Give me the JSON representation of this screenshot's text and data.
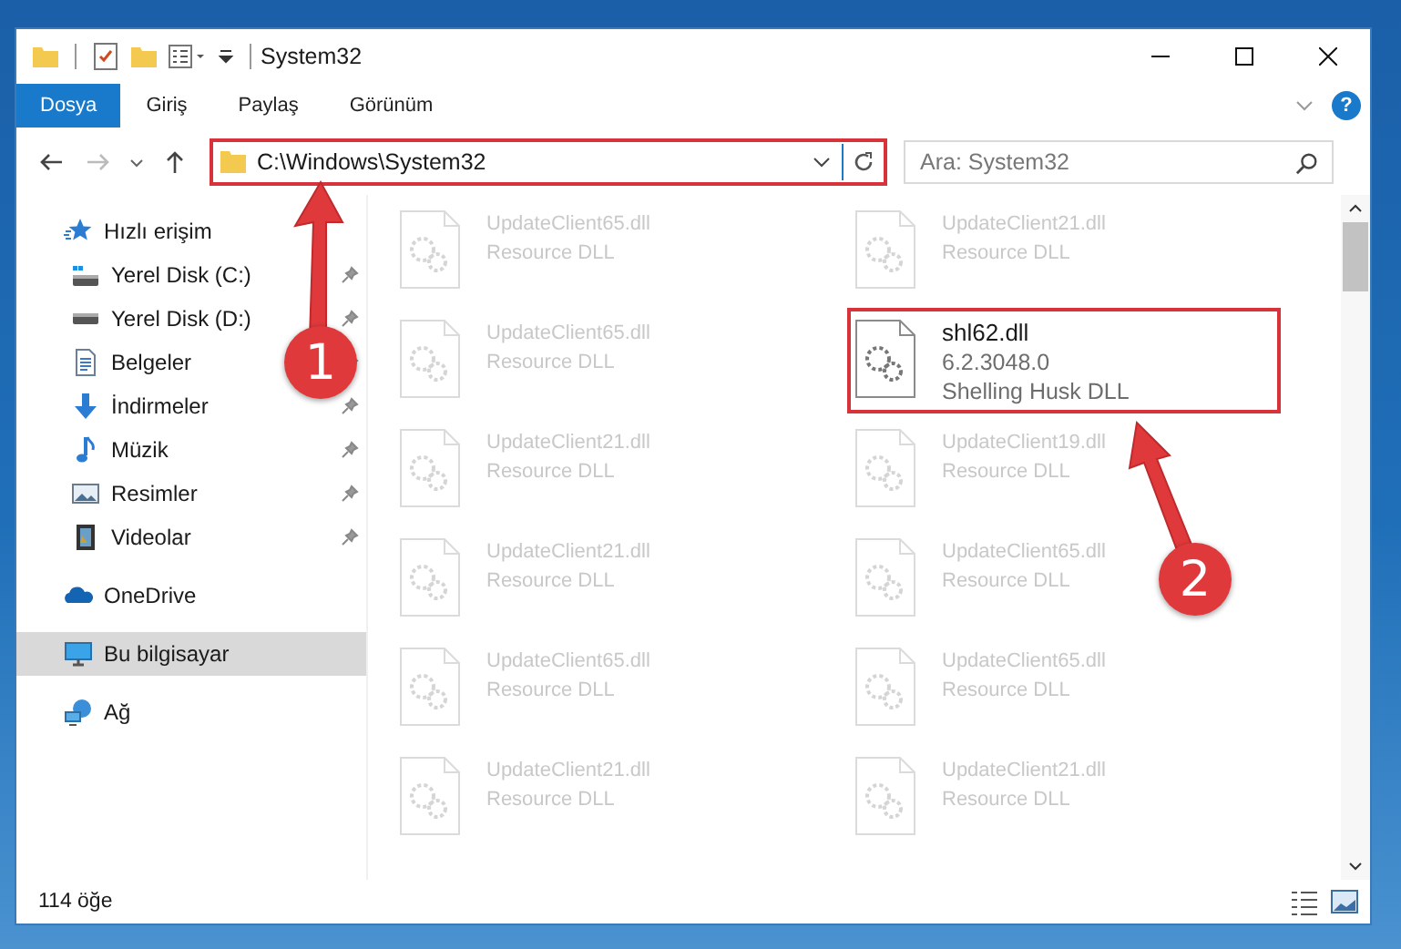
{
  "window": {
    "title": "System32"
  },
  "ribbon": {
    "tabs": [
      {
        "label": "Dosya",
        "selected": true
      },
      {
        "label": "Giriş",
        "selected": false
      },
      {
        "label": "Paylaş",
        "selected": false
      },
      {
        "label": "Görünüm",
        "selected": false
      }
    ],
    "help": "?"
  },
  "address_bar": {
    "path": "C:\\Windows\\System32",
    "annotated": true
  },
  "search": {
    "placeholder": "Ara: System32"
  },
  "sidebar": {
    "items": [
      {
        "label": "Hızlı erişim",
        "kind": "star",
        "selected": false,
        "children": [
          {
            "label": "Yerel Disk (C:)",
            "kind": "system-drive",
            "pinned": true
          },
          {
            "label": "Yerel Disk (D:)",
            "kind": "drive",
            "pinned": true
          },
          {
            "label": "Belgeler",
            "kind": "documents",
            "pinned": true
          },
          {
            "label": "İndirmeler",
            "kind": "downloads",
            "pinned": true
          },
          {
            "label": "Müzik",
            "kind": "music",
            "pinned": true
          },
          {
            "label": "Resimler",
            "kind": "pictures",
            "pinned": true
          },
          {
            "label": "Videolar",
            "kind": "videos",
            "pinned": true
          }
        ]
      },
      {
        "label": "OneDrive",
        "kind": "cloud",
        "selected": false
      },
      {
        "label": "Bu bilgisayar",
        "kind": "computer",
        "selected": true
      },
      {
        "label": "Ağ",
        "kind": "network",
        "selected": false
      }
    ]
  },
  "files": [
    {
      "name": "UpdateClient65.dll",
      "description": "Resource DLL",
      "blurred": true,
      "annotated": false
    },
    {
      "name": "UpdateClient21.dll",
      "description": "Resource DLL",
      "blurred": true,
      "annotated": false
    },
    {
      "name": "UpdateClient65.dll",
      "description": "Resource DLL",
      "blurred": true,
      "annotated": false
    },
    {
      "name": "shl62.dll",
      "version": "6.2.3048.0",
      "description": "Shelling Husk DLL",
      "blurred": false,
      "annotated": true
    },
    {
      "name": "UpdateClient21.dll",
      "description": "Resource DLL",
      "blurred": true,
      "annotated": false
    },
    {
      "name": "UpdateClient19.dll",
      "description": "Resource DLL",
      "blurred": true,
      "annotated": false
    },
    {
      "name": "UpdateClient21.dll",
      "description": "Resource DLL",
      "blurred": true,
      "annotated": false
    },
    {
      "name": "UpdateClient65.dll",
      "description": "Resource DLL",
      "blurred": true,
      "annotated": false
    },
    {
      "name": "UpdateClient65.dll",
      "description": "Resource DLL",
      "blurred": true,
      "annotated": false
    },
    {
      "name": "UpdateClient65.dll",
      "description": "Resource DLL",
      "blurred": true,
      "annotated": false
    },
    {
      "name": "UpdateClient21.dll",
      "description": "Resource DLL",
      "blurred": true,
      "annotated": false
    },
    {
      "name": "UpdateClient21.dll",
      "description": "Resource DLL",
      "blurred": true,
      "annotated": false
    }
  ],
  "status_bar": {
    "item_count": "114 öğe"
  },
  "annotations": [
    {
      "number": "1"
    },
    {
      "number": "2"
    }
  ]
}
